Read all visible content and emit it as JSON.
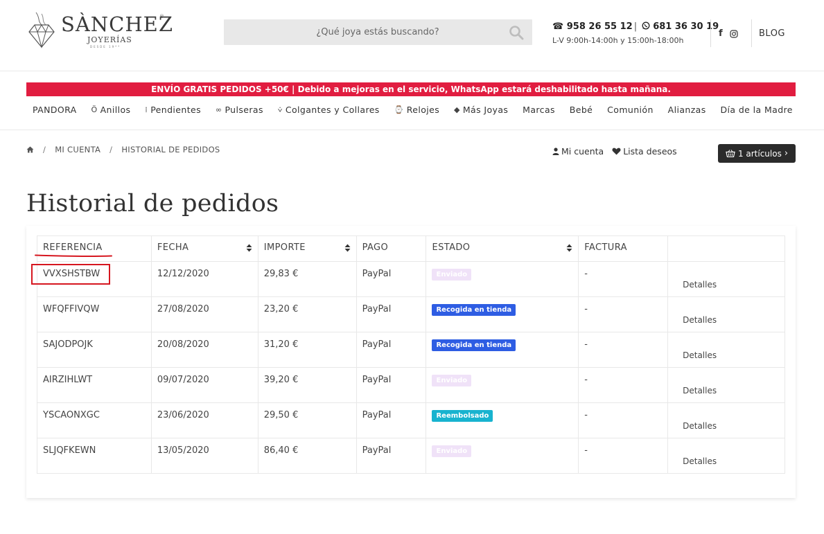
{
  "header": {
    "logo": {
      "name": "SÀNCHEZ",
      "reg": "®",
      "sub": "JOYERÍAS",
      "since": "DESDE 19**"
    },
    "search": {
      "placeholder": "¿Qué joya estás buscando?"
    },
    "contact": {
      "phone1": "958 26 55 12",
      "separator": "|",
      "phone2": "681 36 30 19",
      "hours": "L-V 9:00h-14:00h y 15:00h-18:00h"
    },
    "social": {
      "facebook_icon": "facebook-icon",
      "instagram_icon": "instagram-icon"
    },
    "blog_label": "BLOG"
  },
  "banner": {
    "text": "ENVÍO GRATIS PEDIDOS +50€ | Debido a mejoras en el servicio, WhatsApp estará deshabilitado hasta mañana.",
    "color": "#e11d40"
  },
  "menu": {
    "items": [
      {
        "label": "PANDORA",
        "icon": ""
      },
      {
        "label": "Anillos",
        "icon": "ring-icon"
      },
      {
        "label": "Pendientes",
        "icon": "earrings-icon"
      },
      {
        "label": "Pulseras",
        "icon": "bracelet-icon"
      },
      {
        "label": "Colgantes y Collares",
        "icon": "necklace-icon"
      },
      {
        "label": "Relojes",
        "icon": "watch-icon"
      },
      {
        "label": "Más Joyas",
        "icon": "diamond-icon"
      },
      {
        "label": "Marcas",
        "icon": ""
      },
      {
        "label": "Bebé",
        "icon": ""
      },
      {
        "label": "Comunión",
        "icon": ""
      },
      {
        "label": "Alianzas",
        "icon": ""
      },
      {
        "label": "Día de la Madre",
        "icon": ""
      }
    ]
  },
  "breadcrumb": {
    "sep": "/",
    "items": [
      "MI CUENTA",
      "HISTORIAL DE PEDIDOS"
    ]
  },
  "account": {
    "my_account": "Mi cuenta",
    "wishlist": "Lista deseos",
    "cart": "1 artículos"
  },
  "page": {
    "title": "Historial de pedidos"
  },
  "orders": {
    "headers": [
      "REFERENCIA",
      "FECHA",
      "IMPORTE",
      "PAGO",
      "ESTADO",
      "FACTURA",
      ""
    ],
    "details_label": "Detalles",
    "rows": [
      {
        "ref": "VVXSHSTBW",
        "date": "12/12/2020",
        "amount": "29,83 €",
        "payment": "PayPal",
        "status": "Enviado",
        "status_kind": "env",
        "invoice": "-"
      },
      {
        "ref": "WFQFFIVQW",
        "date": "27/08/2020",
        "amount": "23,20 €",
        "payment": "PayPal",
        "status": "Recogida en tienda",
        "status_kind": "rec",
        "invoice": "-"
      },
      {
        "ref": "SAJODPOJK",
        "date": "20/08/2020",
        "amount": "31,20 €",
        "payment": "PayPal",
        "status": "Recogida en tienda",
        "status_kind": "rec",
        "invoice": "-"
      },
      {
        "ref": "AIRZIHLWT",
        "date": "09/07/2020",
        "amount": "39,20 €",
        "payment": "PayPal",
        "status": "Enviado",
        "status_kind": "env",
        "invoice": "-"
      },
      {
        "ref": "YSCAONXGC",
        "date": "23/06/2020",
        "amount": "29,50 €",
        "payment": "PayPal",
        "status": "Reembolsado",
        "status_kind": "ree",
        "invoice": "-"
      },
      {
        "ref": "SLJQFKEWN",
        "date": "13/05/2020",
        "amount": "86,40 €",
        "payment": "PayPal",
        "status": "Enviado",
        "status_kind": "env",
        "invoice": "-"
      }
    ]
  },
  "colors": {
    "enviado": "#f0e2f8",
    "recogida": "#2e5de3",
    "reembolsado": "#18b3cf",
    "annotation": "#d6161f"
  }
}
